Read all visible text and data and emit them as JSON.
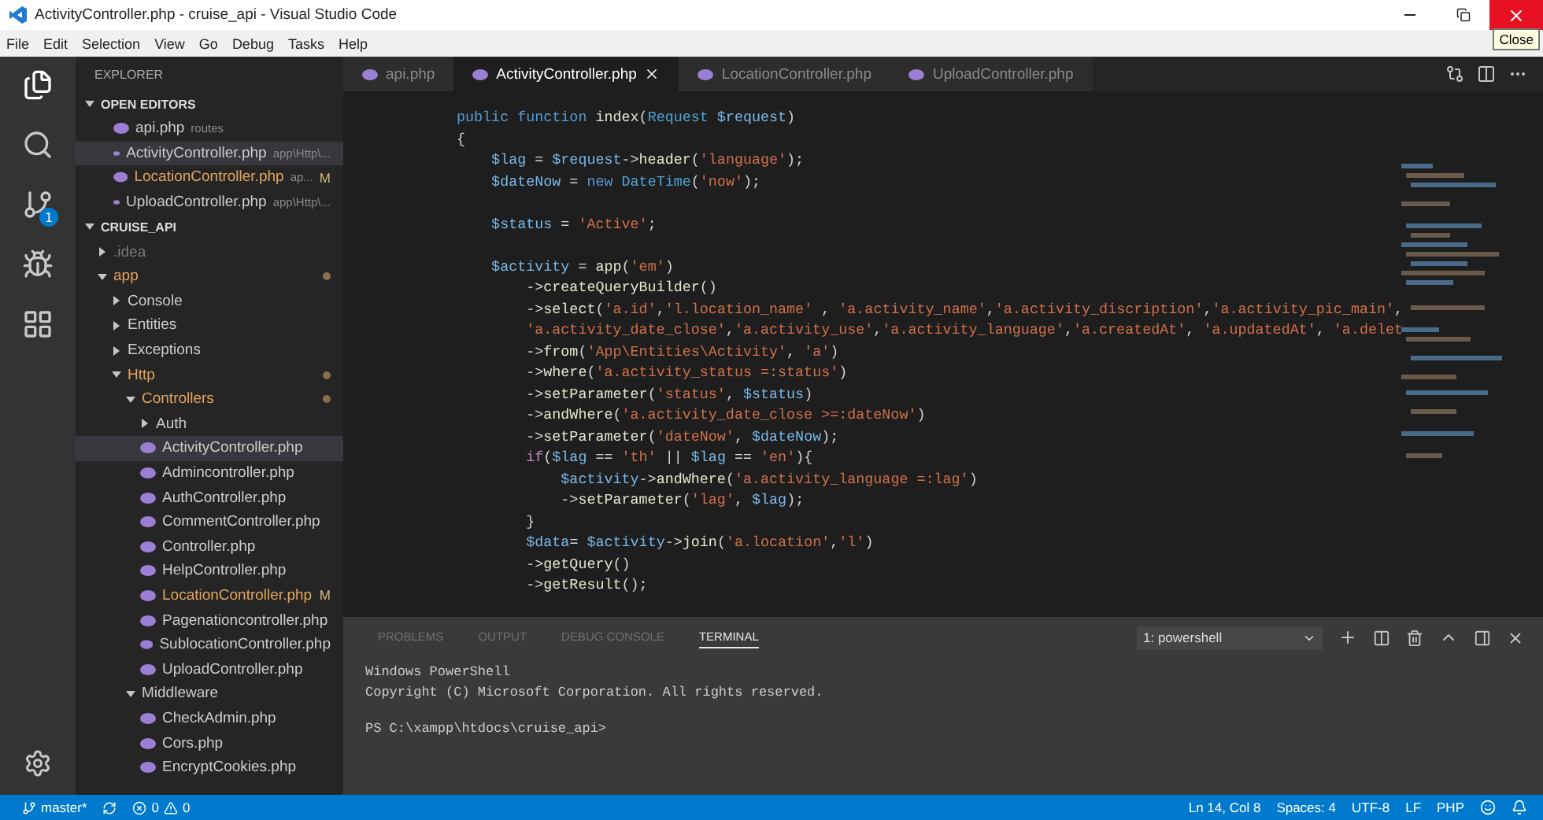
{
  "window": {
    "title": "ActivityController.php - cruise_api - Visual Studio Code",
    "tooltip": "Close"
  },
  "menu": [
    "File",
    "Edit",
    "Selection",
    "View",
    "Go",
    "Debug",
    "Tasks",
    "Help"
  ],
  "activity_bar": [
    {
      "kind": "files",
      "selected": true
    },
    {
      "kind": "search",
      "selected": false
    },
    {
      "kind": "source-control",
      "selected": false,
      "badge": "1"
    },
    {
      "kind": "debug",
      "selected": false
    },
    {
      "kind": "extensions",
      "selected": false
    }
  ],
  "sidebar": {
    "title": "EXPLORER",
    "open_editors": {
      "title": "OPEN EDITORS",
      "expanded": true,
      "items": [
        {
          "label": "api.php",
          "detail": "routes",
          "selected": false,
          "modified": false
        },
        {
          "label": "ActivityController.php",
          "detail": "app\\Http\\...",
          "selected": true,
          "modified": false
        },
        {
          "label": "LocationController.php",
          "detail": "ap...",
          "selected": false,
          "modified": true,
          "badge": "M"
        },
        {
          "label": "UploadController.php",
          "detail": "app\\Http\\...",
          "selected": false,
          "modified": false
        }
      ]
    },
    "project": {
      "title": "CRUISE_API",
      "expanded": true,
      "tree": [
        {
          "label": ".idea",
          "kind": "folder",
          "expanded": false,
          "modified": false,
          "ignored": true,
          "selected": false
        },
        {
          "label": "app",
          "kind": "folder",
          "expanded": true,
          "modified": true,
          "ignored": false,
          "selected": false,
          "children": [
            {
              "label": "Console",
              "kind": "folder",
              "expanded": false,
              "modified": false,
              "ignored": false,
              "selected": false
            },
            {
              "label": "Entities",
              "kind": "folder",
              "expanded": false,
              "modified": false,
              "ignored": false,
              "selected": false
            },
            {
              "label": "Exceptions",
              "kind": "folder",
              "expanded": false,
              "modified": false,
              "ignored": false,
              "selected": false
            },
            {
              "label": "Http",
              "kind": "folder",
              "expanded": true,
              "modified": true,
              "ignored": false,
              "selected": false,
              "children": [
                {
                  "label": "Controllers",
                  "kind": "folder",
                  "expanded": true,
                  "modified": true,
                  "ignored": false,
                  "selected": false,
                  "children": [
                    {
                      "label": "Auth",
                      "kind": "folder",
                      "expanded": false,
                      "modified": false,
                      "ignored": false,
                      "selected": false
                    },
                    {
                      "label": "ActivityController.php",
                      "kind": "file",
                      "modified": false,
                      "ignored": false,
                      "selected": true
                    },
                    {
                      "label": "Admincontroller.php",
                      "kind": "file",
                      "modified": false,
                      "ignored": false,
                      "selected": false
                    },
                    {
                      "label": "AuthController.php",
                      "kind": "file",
                      "modified": false,
                      "ignored": false,
                      "selected": false
                    },
                    {
                      "label": "CommentController.php",
                      "kind": "file",
                      "modified": false,
                      "ignored": false,
                      "selected": false
                    },
                    {
                      "label": "Controller.php",
                      "kind": "file",
                      "modified": false,
                      "ignored": false,
                      "selected": false
                    },
                    {
                      "label": "HelpController.php",
                      "kind": "file",
                      "modified": false,
                      "ignored": false,
                      "selected": false
                    },
                    {
                      "label": "LocationController.php",
                      "kind": "file",
                      "modified": true,
                      "ignored": false,
                      "selected": false,
                      "badge": "M"
                    },
                    {
                      "label": "Pagenationcontroller.php",
                      "kind": "file",
                      "modified": false,
                      "ignored": false,
                      "selected": false
                    },
                    {
                      "label": "SublocationController.php",
                      "kind": "file",
                      "modified": false,
                      "ignored": false,
                      "selected": false
                    },
                    {
                      "label": "UploadController.php",
                      "kind": "file",
                      "modified": false,
                      "ignored": false,
                      "selected": false
                    }
                  ]
                },
                {
                  "label": "Middleware",
                  "kind": "folder",
                  "expanded": true,
                  "modified": false,
                  "ignored": false,
                  "selected": false,
                  "children": [
                    {
                      "label": "CheckAdmin.php",
                      "kind": "file",
                      "modified": false,
                      "ignored": false,
                      "selected": false
                    },
                    {
                      "label": "Cors.php",
                      "kind": "file",
                      "modified": false,
                      "ignored": false,
                      "selected": false
                    },
                    {
                      "label": "EncryptCookies.php",
                      "kind": "file",
                      "modified": false,
                      "ignored": false,
                      "selected": false
                    }
                  ]
                }
              ]
            }
          ]
        }
      ]
    }
  },
  "tabs": [
    {
      "label": "api.php",
      "selected": false
    },
    {
      "label": "ActivityController.php",
      "selected": true
    },
    {
      "label": "LocationController.php",
      "selected": false
    },
    {
      "label": "UploadController.php",
      "selected": false
    }
  ],
  "code": [
    {
      "kind": "code",
      "tokens": [
        {
          "kind": "kw",
          "text": "public function "
        },
        {
          "kind": "fn",
          "text": "index"
        },
        {
          "kind": "plain",
          "text": "("
        },
        {
          "kind": "type",
          "text": "Request "
        },
        {
          "kind": "var",
          "text": "$request"
        },
        {
          "kind": "plain",
          "text": ")"
        }
      ]
    },
    {
      "kind": "code",
      "tokens": [
        {
          "kind": "plain",
          "text": "{"
        }
      ]
    },
    {
      "kind": "code",
      "tokens": [
        {
          "kind": "var",
          "text": "    $lag"
        },
        {
          "kind": "plain",
          "text": " = "
        },
        {
          "kind": "var",
          "text": "$request"
        },
        {
          "kind": "plain",
          "text": "->"
        },
        {
          "kind": "fn",
          "text": "header"
        },
        {
          "kind": "plain",
          "text": "("
        },
        {
          "kind": "str",
          "text": "'language'"
        },
        {
          "kind": "plain",
          "text": ");"
        }
      ]
    },
    {
      "kind": "code",
      "tokens": [
        {
          "kind": "var",
          "text": "    $dateNow"
        },
        {
          "kind": "plain",
          "text": " = "
        },
        {
          "kind": "kw",
          "text": "new "
        },
        {
          "kind": "type",
          "text": "DateTime"
        },
        {
          "kind": "plain",
          "text": "("
        },
        {
          "kind": "str",
          "text": "'now'"
        },
        {
          "kind": "plain",
          "text": ");"
        }
      ]
    },
    {
      "kind": "blank"
    },
    {
      "kind": "code",
      "tokens": [
        {
          "kind": "var",
          "text": "    $status"
        },
        {
          "kind": "plain",
          "text": " = "
        },
        {
          "kind": "str",
          "text": "'Active'"
        },
        {
          "kind": "plain",
          "text": ";"
        }
      ]
    },
    {
      "kind": "blank"
    },
    {
      "kind": "code",
      "tokens": [
        {
          "kind": "var",
          "text": "    $activity"
        },
        {
          "kind": "plain",
          "text": " = "
        },
        {
          "kind": "fn",
          "text": "app"
        },
        {
          "kind": "plain",
          "text": "("
        },
        {
          "kind": "str",
          "text": "'em'"
        },
        {
          "kind": "plain",
          "text": ")"
        }
      ]
    },
    {
      "kind": "code",
      "tokens": [
        {
          "kind": "plain",
          "text": "        ->"
        },
        {
          "kind": "fn",
          "text": "createQueryBuilder"
        },
        {
          "kind": "plain",
          "text": "()"
        }
      ]
    },
    {
      "kind": "code",
      "tokens": [
        {
          "kind": "plain",
          "text": "        ->"
        },
        {
          "kind": "fn",
          "text": "select"
        },
        {
          "kind": "plain",
          "text": "("
        },
        {
          "kind": "str",
          "text": "'a.id'"
        },
        {
          "kind": "plain",
          "text": ","
        },
        {
          "kind": "str",
          "text": "'l.location_name'"
        },
        {
          "kind": "plain",
          "text": " , "
        },
        {
          "kind": "str",
          "text": "'a.activity_name'"
        },
        {
          "kind": "plain",
          "text": ","
        },
        {
          "kind": "str",
          "text": "'a.activity_discription'"
        },
        {
          "kind": "plain",
          "text": ","
        },
        {
          "kind": "str",
          "text": "'a.activity_pic_main'"
        },
        {
          "kind": "plain",
          "text": ","
        }
      ]
    },
    {
      "kind": "code",
      "tokens": [
        {
          "kind": "str",
          "text": "        'a.activity_date_close'"
        },
        {
          "kind": "plain",
          "text": ","
        },
        {
          "kind": "str",
          "text": "'a.activity_use'"
        },
        {
          "kind": "plain",
          "text": ","
        },
        {
          "kind": "str",
          "text": "'a.activity_language'"
        },
        {
          "kind": "plain",
          "text": ","
        },
        {
          "kind": "str",
          "text": "'a.createdAt'"
        },
        {
          "kind": "plain",
          "text": ", "
        },
        {
          "kind": "str",
          "text": "'a.updatedAt'"
        },
        {
          "kind": "plain",
          "text": ", "
        },
        {
          "kind": "str",
          "text": "'a.delet"
        }
      ]
    },
    {
      "kind": "code",
      "tokens": [
        {
          "kind": "plain",
          "text": "        ->"
        },
        {
          "kind": "fn",
          "text": "from"
        },
        {
          "kind": "plain",
          "text": "("
        },
        {
          "kind": "str",
          "text": "'App\\Entities\\Activity'"
        },
        {
          "kind": "plain",
          "text": ", "
        },
        {
          "kind": "str",
          "text": "'a'"
        },
        {
          "kind": "plain",
          "text": ")"
        }
      ]
    },
    {
      "kind": "code",
      "tokens": [
        {
          "kind": "plain",
          "text": "        ->"
        },
        {
          "kind": "fn",
          "text": "where"
        },
        {
          "kind": "plain",
          "text": "("
        },
        {
          "kind": "str",
          "text": "'a.activity_status =:status'"
        },
        {
          "kind": "plain",
          "text": ")"
        }
      ]
    },
    {
      "kind": "code",
      "tokens": [
        {
          "kind": "plain",
          "text": "        ->"
        },
        {
          "kind": "fn",
          "text": "setParameter"
        },
        {
          "kind": "plain",
          "text": "("
        },
        {
          "kind": "str",
          "text": "'status'"
        },
        {
          "kind": "plain",
          "text": ", "
        },
        {
          "kind": "var",
          "text": "$status"
        },
        {
          "kind": "plain",
          "text": ")"
        }
      ]
    },
    {
      "kind": "code",
      "tokens": [
        {
          "kind": "plain",
          "text": "        ->"
        },
        {
          "kind": "fn",
          "text": "andWhere"
        },
        {
          "kind": "plain",
          "text": "("
        },
        {
          "kind": "str",
          "text": "'a.activity_date_close >=:dateNow'"
        },
        {
          "kind": "plain",
          "text": ")"
        }
      ]
    },
    {
      "kind": "code",
      "tokens": [
        {
          "kind": "plain",
          "text": "        ->"
        },
        {
          "kind": "fn",
          "text": "setParameter"
        },
        {
          "kind": "plain",
          "text": "("
        },
        {
          "kind": "str",
          "text": "'dateNow'"
        },
        {
          "kind": "plain",
          "text": ", "
        },
        {
          "kind": "var",
          "text": "$dateNow"
        },
        {
          "kind": "plain",
          "text": ");"
        }
      ]
    },
    {
      "kind": "code",
      "tokens": [
        {
          "kind": "ctrl",
          "text": "        if"
        },
        {
          "kind": "plain",
          "text": "("
        },
        {
          "kind": "var",
          "text": "$lag"
        },
        {
          "kind": "plain",
          "text": " == "
        },
        {
          "kind": "str",
          "text": "'th'"
        },
        {
          "kind": "plain",
          "text": " || "
        },
        {
          "kind": "var",
          "text": "$lag"
        },
        {
          "kind": "plain",
          "text": " == "
        },
        {
          "kind": "str",
          "text": "'en'"
        },
        {
          "kind": "plain",
          "text": "){"
        }
      ]
    },
    {
      "kind": "code",
      "tokens": [
        {
          "kind": "var",
          "text": "            $activity"
        },
        {
          "kind": "plain",
          "text": "->"
        },
        {
          "kind": "fn",
          "text": "andWhere"
        },
        {
          "kind": "plain",
          "text": "("
        },
        {
          "kind": "str",
          "text": "'a.activity_language =:lag'"
        },
        {
          "kind": "plain",
          "text": ")"
        }
      ]
    },
    {
      "kind": "code",
      "tokens": [
        {
          "kind": "plain",
          "text": "            ->"
        },
        {
          "kind": "fn",
          "text": "setParameter"
        },
        {
          "kind": "plain",
          "text": "("
        },
        {
          "kind": "str",
          "text": "'lag'"
        },
        {
          "kind": "plain",
          "text": ", "
        },
        {
          "kind": "var",
          "text": "$lag"
        },
        {
          "kind": "plain",
          "text": ");"
        }
      ]
    },
    {
      "kind": "code",
      "tokens": [
        {
          "kind": "plain",
          "text": "        }"
        }
      ]
    },
    {
      "kind": "code",
      "tokens": [
        {
          "kind": "var",
          "text": "        $data"
        },
        {
          "kind": "plain",
          "text": "= "
        },
        {
          "kind": "var",
          "text": "$activity"
        },
        {
          "kind": "plain",
          "text": "->"
        },
        {
          "kind": "fn",
          "text": "join"
        },
        {
          "kind": "plain",
          "text": "("
        },
        {
          "kind": "str",
          "text": "'a.location'"
        },
        {
          "kind": "plain",
          "text": ","
        },
        {
          "kind": "str",
          "text": "'l'"
        },
        {
          "kind": "plain",
          "text": ")"
        }
      ]
    },
    {
      "kind": "code",
      "tokens": [
        {
          "kind": "plain",
          "text": "        ->"
        },
        {
          "kind": "fn",
          "text": "getQuery"
        },
        {
          "kind": "plain",
          "text": "()"
        }
      ]
    },
    {
      "kind": "code",
      "tokens": [
        {
          "kind": "plain",
          "text": "        ->"
        },
        {
          "kind": "fn",
          "text": "getResult"
        },
        {
          "kind": "plain",
          "text": "();"
        }
      ]
    }
  ],
  "panel": {
    "tabs": [
      {
        "label": "PROBLEMS",
        "selected": false
      },
      {
        "label": "OUTPUT",
        "selected": false
      },
      {
        "label": "DEBUG CONSOLE",
        "selected": false
      },
      {
        "label": "TERMINAL",
        "selected": true
      }
    ],
    "terminal_select": "1: powershell",
    "output": [
      "Windows PowerShell",
      "Copyright (C) Microsoft Corporation. All rights reserved."
    ],
    "prompt": "PS C:\\xampp\\htdocs\\cruise_api>"
  },
  "status_bar": {
    "branch": "master*",
    "errors": "0",
    "warnings": "0",
    "position": "Ln 14, Col 8",
    "indentation": "Spaces: 4",
    "encoding": "UTF-8",
    "eol": "LF",
    "language": "PHP"
  }
}
